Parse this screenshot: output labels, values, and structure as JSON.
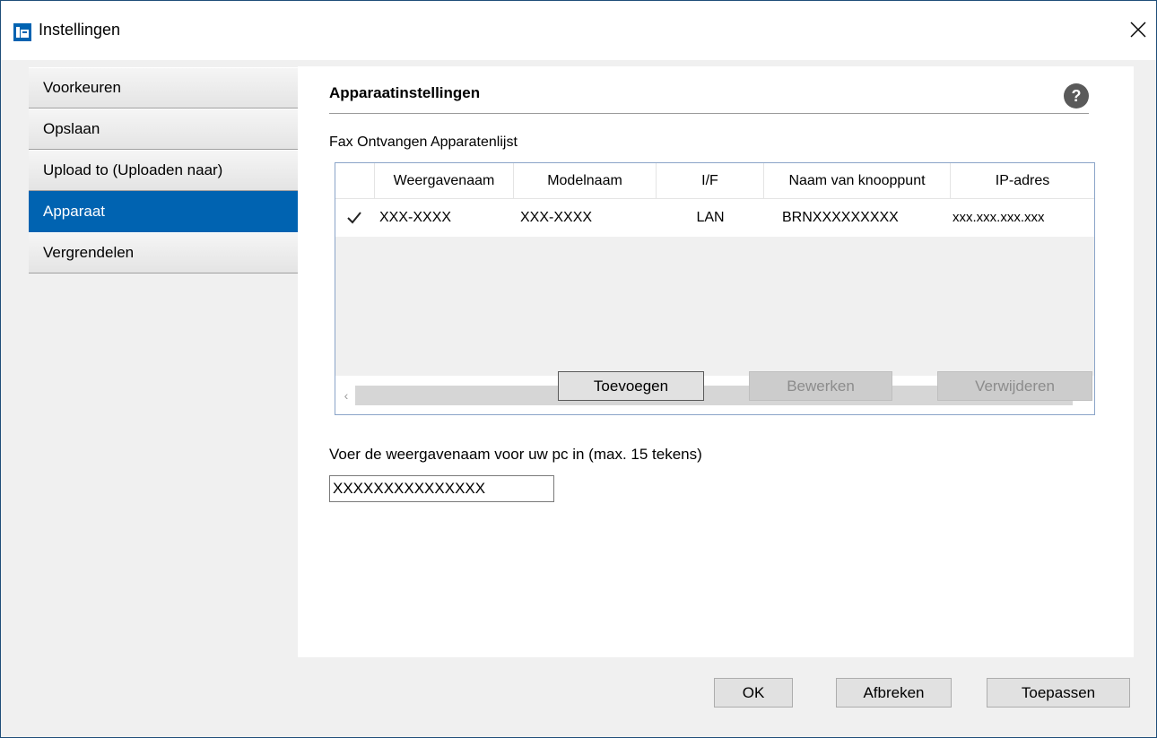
{
  "window": {
    "title": "Instellingen",
    "app_icon": "settings-app-icon",
    "close_icon": "close-icon"
  },
  "sidebar": {
    "items": [
      {
        "label": "Voorkeuren",
        "active": false
      },
      {
        "label": "Opslaan",
        "active": false
      },
      {
        "label": "Upload to (Uploaden naar)",
        "active": false
      },
      {
        "label": "Apparaat",
        "active": true
      },
      {
        "label": "Vergrendelen",
        "active": false
      }
    ]
  },
  "panel": {
    "title": "Apparaatinstellingen",
    "help_icon_glyph": "?",
    "list_label": "Fax Ontvangen Apparatenlijst",
    "table": {
      "columns": [
        "Weergavenaam",
        "Modelnaam",
        "I/F",
        "Naam van knooppunt",
        "IP-adres"
      ],
      "rows": [
        {
          "checked": true,
          "cells": [
            "XXX-XXXX",
            "XXX-XXXX",
            "LAN",
            "BRNXXXXXXXXX",
            "xxx.xxx.xxx.xxx"
          ]
        }
      ],
      "scroll_left_glyph": "‹",
      "scroll_right_glyph": "›"
    },
    "buttons": {
      "add": "Toevoegen",
      "edit": "Bewerken",
      "delete": "Verwijderen"
    },
    "name_field": {
      "label": "Voer de weergavenaam voor uw pc in (max. 15 tekens)",
      "value": "XXXXXXXXXXXXXXX"
    }
  },
  "footer": {
    "ok": "OK",
    "cancel": "Afbreken",
    "apply": "Toepassen"
  },
  "colors": {
    "accent": "#0063b1",
    "window_border": "#1f4e79"
  }
}
